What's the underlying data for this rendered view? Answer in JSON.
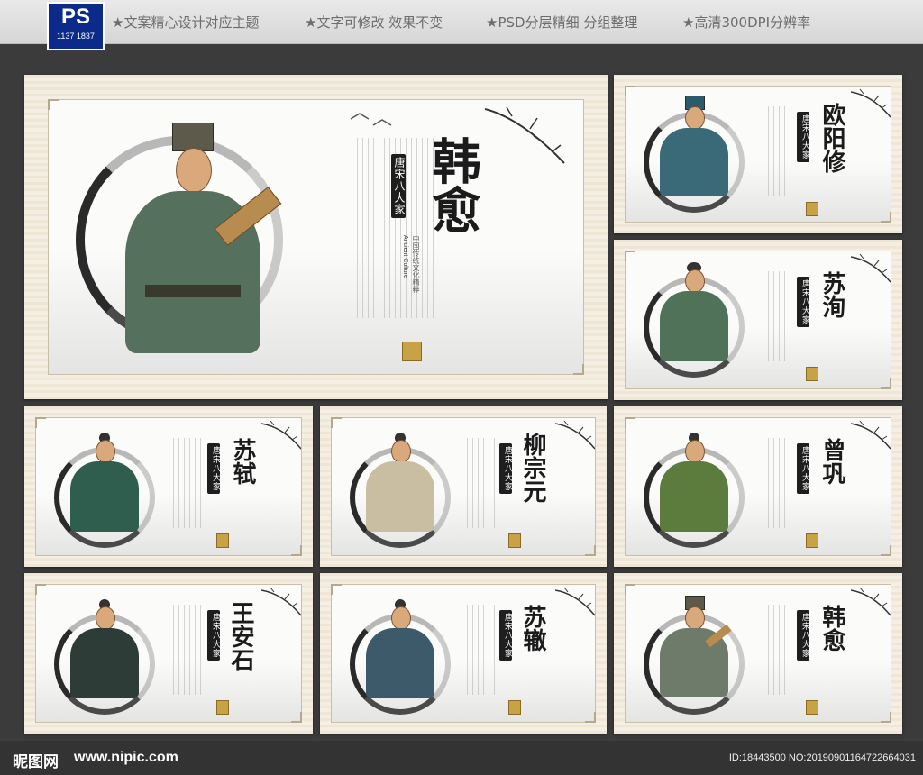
{
  "header": {
    "logo_ps": "PS",
    "logo_number": "1137 1837",
    "features": [
      "★文案精心设计对应主题",
      "★文字可修改 效果不变",
      "★PSD分层精细 分组整理",
      "★高清300DPI分辨率"
    ]
  },
  "main_panel": {
    "series_label": "唐宋八大家",
    "name": "韩愈",
    "subtitle_en": "Ancient Culture",
    "subtitle_cn": "中国传统文化精粹"
  },
  "panels": [
    {
      "series_label": "唐宋八大家",
      "name": "欧阳修",
      "robe": "#3a6a78"
    },
    {
      "series_label": "唐宋八大家",
      "name": "苏洵",
      "robe": "#4f7258"
    },
    {
      "series_label": "唐宋八大家",
      "name": "苏轼",
      "robe": "#2f5e4f"
    },
    {
      "series_label": "唐宋八大家",
      "name": "柳宗元",
      "robe": "#c9bea2"
    },
    {
      "series_label": "唐宋八大家",
      "name": "曾巩",
      "robe": "#5b7c3d"
    },
    {
      "series_label": "唐宋八大家",
      "name": "王安石",
      "robe": "#2e3c38"
    },
    {
      "series_label": "唐宋八大家",
      "name": "苏辙",
      "robe": "#3d5a6a"
    },
    {
      "series_label": "唐宋八大家",
      "name": "韩愈",
      "robe": "#6e7a6a"
    }
  ],
  "footer": {
    "brand": "昵图网",
    "site": "www.nipic.com",
    "id_text": "ID:18443500 NO:20190901164722664031"
  }
}
